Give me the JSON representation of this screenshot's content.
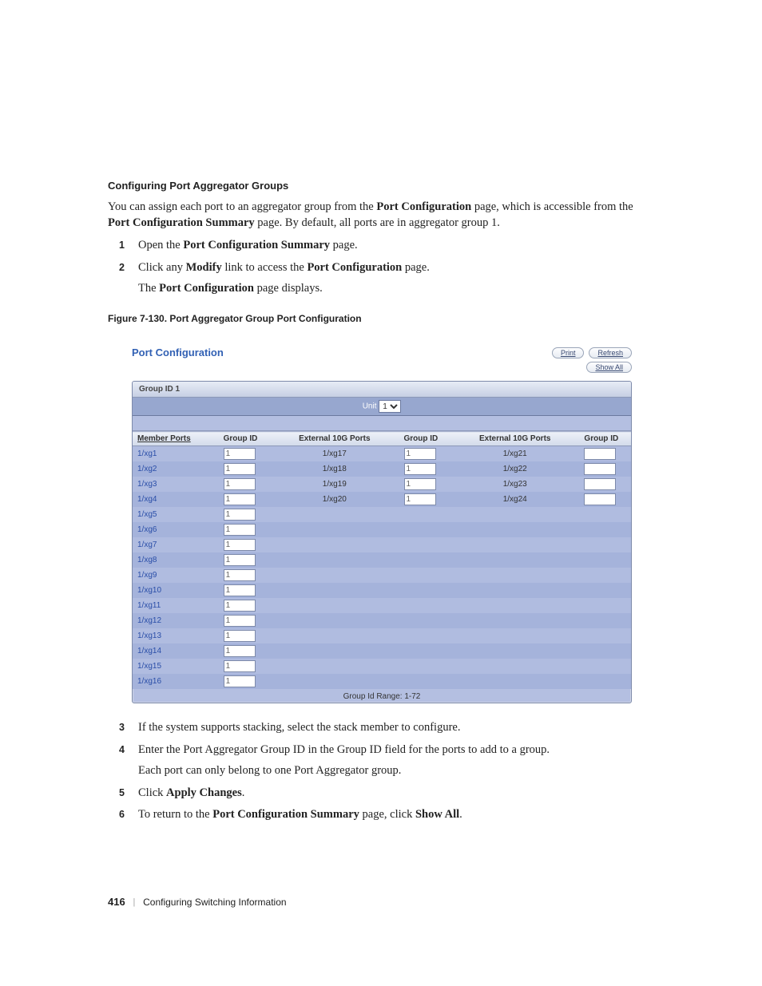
{
  "section_heading": "Configuring Port Aggregator Groups",
  "intro_parts": {
    "a": "You can assign each port to an aggregator group from the ",
    "b": "Port Configuration",
    "c": " page, which is accessible from the ",
    "d": "Port Configuration Summary",
    "e": " page. By default, all ports are in aggregator group 1."
  },
  "steps_top": [
    {
      "pre": "Open the ",
      "bold": "Port Configuration Summary",
      "post": " page."
    },
    {
      "pre": "Click any ",
      "bold": "Modify",
      "mid": " link to access the ",
      "bold2": "Port Configuration",
      "post": " page.",
      "extraPre": "The ",
      "extraBold": "Port Configuration",
      "extraPost": " page displays."
    }
  ],
  "figure_caption": "Figure 7-130.    Port Aggregator Group Port Configuration",
  "screenshot": {
    "title": "Port Configuration",
    "btn_print": "Print",
    "btn_refresh": "Refresh",
    "btn_showall": "Show All",
    "group_label": "Group ID 1",
    "unit_label": "Unit",
    "unit_value": "1",
    "headers": {
      "member": "Member Ports",
      "gid": "Group ID",
      "ext": "External 10G Ports"
    },
    "member_ports": [
      "1/xg1",
      "1/xg2",
      "1/xg3",
      "1/xg4",
      "1/xg5",
      "1/xg6",
      "1/xg7",
      "1/xg8",
      "1/xg9",
      "1/xg10",
      "1/xg11",
      "1/xg12",
      "1/xg13",
      "1/xg14",
      "1/xg15",
      "1/xg16"
    ],
    "member_group_value": "1",
    "ext_col1": [
      "1/xg17",
      "1/xg18",
      "1/xg19",
      "1/xg20"
    ],
    "ext_col2": [
      "1/xg21",
      "1/xg22",
      "1/xg23",
      "1/xg24"
    ],
    "ext_gid1_value": "1",
    "ext_gid2_value": "",
    "range_note": "Group Id Range: 1-72"
  },
  "steps_bottom": [
    {
      "text": "If the system supports stacking, select the stack member to configure."
    },
    {
      "text": "Enter the Port Aggregator Group ID in the Group ID field for the ports to add to a group.",
      "extra": "Each port can only belong to one Port Aggregator group."
    },
    {
      "pre": "Click ",
      "bold": "Apply Changes",
      "post": "."
    },
    {
      "pre": "To return to the ",
      "bold": "Port Configuration Summary",
      "mid": " page, click ",
      "bold2": "Show All",
      "post": "."
    }
  ],
  "footer": {
    "page": "416",
    "chapter": "Configuring Switching Information"
  }
}
